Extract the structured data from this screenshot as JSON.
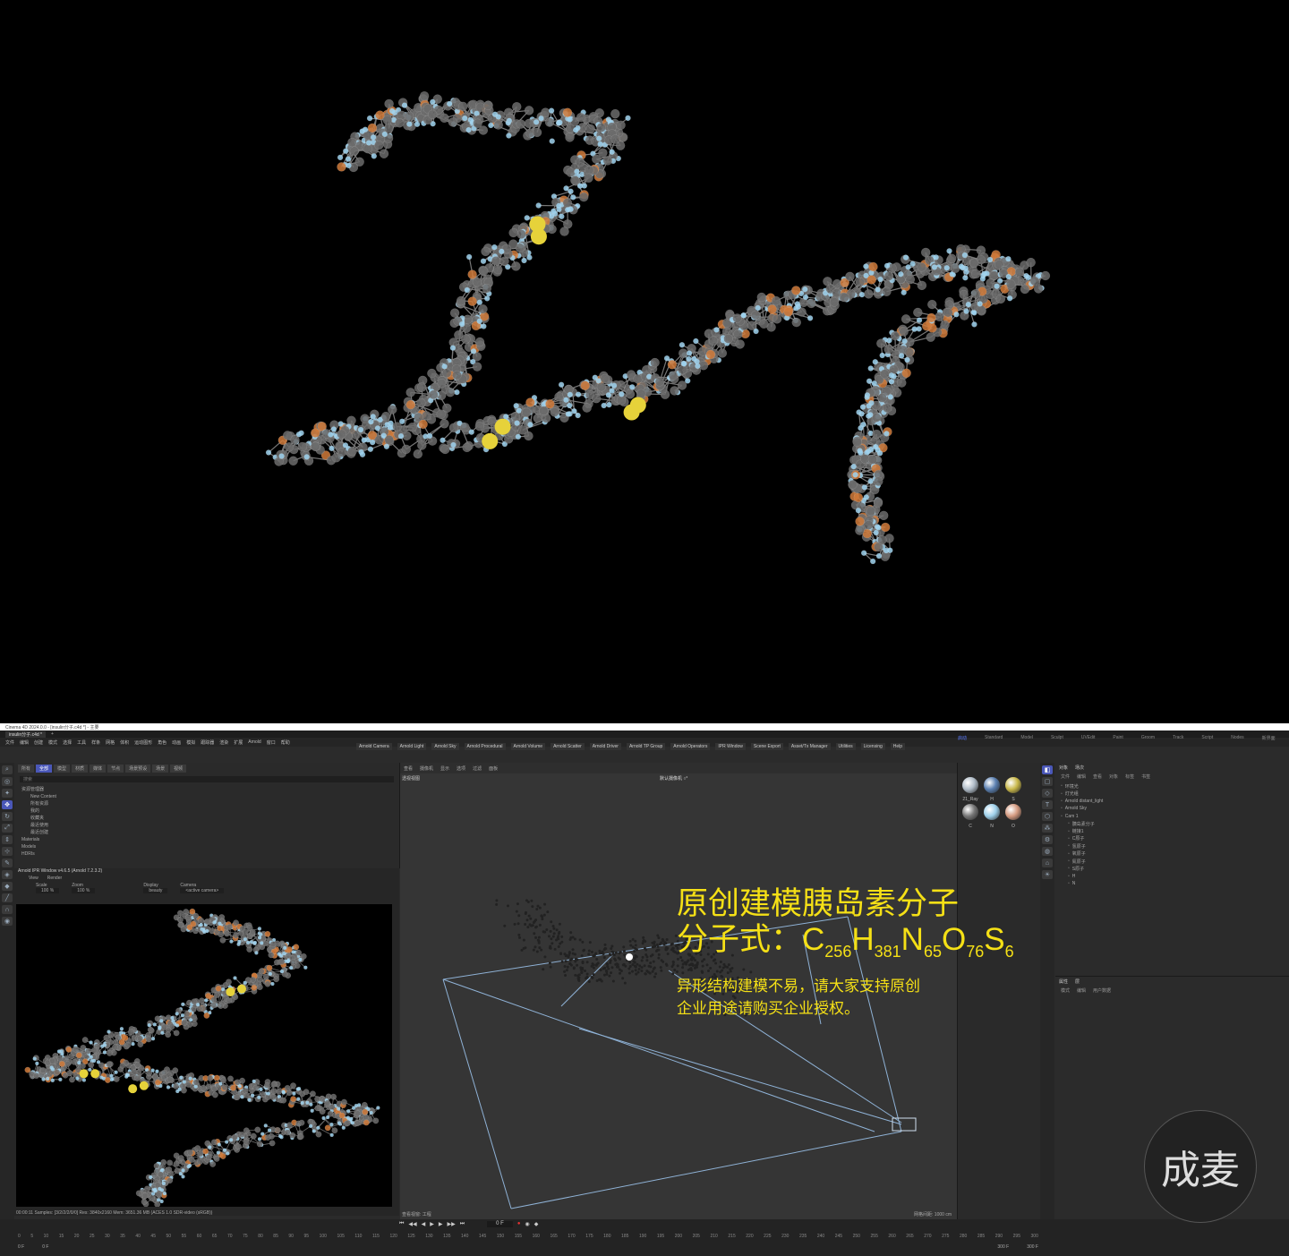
{
  "window": {
    "title": "Cinema 4D 2024.0.0 - [insulin分子.c4d *] - 主要"
  },
  "doc_tab": "insulin分子.c4d *",
  "menu": [
    "文件",
    "编辑",
    "创建",
    "模式",
    "选择",
    "工具",
    "样条",
    "网格",
    "体积",
    "运动图形",
    "角色",
    "动画",
    "模拟",
    "跟踪器",
    "渲染",
    "扩展",
    "Arnold",
    "窗口",
    "帮助"
  ],
  "arnold_toolbar": [
    "Arnold Camera",
    "Arnold Light",
    "Arnold Sky",
    "Arnold Procedural",
    "Arnold Volume",
    "Arnold Scatter",
    "Arnold Driver",
    "Arnold TP Group",
    "Arnold Operators",
    "IPR Window",
    "Scene Export",
    "Asset/Tx Manager",
    "Utilities",
    "Licensing",
    "Help"
  ],
  "layouts": [
    "Standard",
    "Model",
    "Sculpt",
    "UVEdit",
    "Paint",
    "Groom",
    "Track",
    "Script",
    "Nodes"
  ],
  "layouts_active": "启动",
  "new_layout": "新界面",
  "asset_tabs": [
    "所有",
    "全部",
    "模型",
    "材质",
    "媒体",
    "节点",
    "场景预设",
    "场景",
    "视频"
  ],
  "asset_tree": [
    "资源管理器",
    "New Content",
    "所有资源",
    "我的",
    "收藏夹",
    "最近使用",
    "最近创建",
    "Materials",
    "Models",
    "HDRIs"
  ],
  "search_placeholder": "搜索",
  "ipr": {
    "title": "Arnold IPR Window v4.6.5 (Arnold 7.2.3.2)",
    "menu": [
      "View",
      "Render"
    ],
    "scale_label": "Scale",
    "scale_value": "100 %",
    "zoom_label": "Zoom",
    "zoom_value": "100 %",
    "display_label": "Display",
    "display_value": "beauty",
    "camera_label": "Camera",
    "camera_value": "<active camera>",
    "status": "00:00:11  Samples: [3/2/2/2/0/0]  Res: 3840x2160  Mem: 3651.36 MB  (ACES 1.0 SDR-video (sRGB))"
  },
  "viewport": {
    "menu": [
      "查看",
      "摄像机",
      "显示",
      "选项",
      "过滤",
      "面板"
    ],
    "label": "透视视图",
    "camera": "默认摄像机 ○°",
    "status": "查看视窗: 工程",
    "grid": "网格间距: 1000 cm"
  },
  "overlay": {
    "title": "原创建模胰岛素分子",
    "formula_prefix": "分子式：",
    "formula": [
      {
        "el": "C",
        "n": "256"
      },
      {
        "el": "H",
        "n": "381"
      },
      {
        "el": "N",
        "n": "65"
      },
      {
        "el": "O",
        "n": "76"
      },
      {
        "el": "S",
        "n": "6"
      }
    ],
    "note1": "异形结构建模不易，请大家支持原创",
    "note2": "企业用途请购买企业授权。"
  },
  "materials": [
    "21_Ray",
    "H",
    "S",
    "C",
    "N",
    "O"
  ],
  "objects_tabs": [
    "对象",
    "场次"
  ],
  "objects_menu": [
    "文件",
    "编辑",
    "查看",
    "对象",
    "标签",
    "书签"
  ],
  "objects": [
    "Arnold distant_light",
    "Arnold Sky",
    "Cam 1",
    "胰岛素分子",
    "链接1",
    "C原子",
    "氢原子",
    "氧原子",
    "氮原子",
    "S原子",
    "H",
    "N"
  ],
  "objects_extra": [
    "环境光",
    "灯光组"
  ],
  "attr_tabs": [
    "属性",
    "层"
  ],
  "attr_menu": [
    "模式",
    "编辑",
    "用户数据"
  ],
  "timeline": {
    "frame_current": "0 F",
    "start": "0 F",
    "start2": "0 F",
    "end": "300 F",
    "end2": "300 F",
    "ticks": [
      "0",
      "5",
      "10",
      "15",
      "20",
      "25",
      "30",
      "35",
      "40",
      "45",
      "50",
      "55",
      "60",
      "65",
      "70",
      "75",
      "80",
      "85",
      "90",
      "95",
      "100",
      "105",
      "110",
      "115",
      "120",
      "125",
      "130",
      "135",
      "140",
      "145",
      "150",
      "155",
      "160",
      "165",
      "170",
      "175",
      "180",
      "185",
      "190",
      "195",
      "200",
      "205",
      "210",
      "215",
      "220",
      "225",
      "230",
      "235",
      "240",
      "245",
      "250",
      "255",
      "260",
      "265",
      "270",
      "275",
      "280",
      "285",
      "290",
      "295",
      "300"
    ]
  },
  "logo": "成麦",
  "colors": {
    "accent": "#4a57b8",
    "overlay_text": "#f5e016",
    "carbon": "#6b6b6b",
    "hydrogen": "#9fd4f0",
    "oxygen": "#d07a3a",
    "sulfur": "#e6d23a"
  }
}
